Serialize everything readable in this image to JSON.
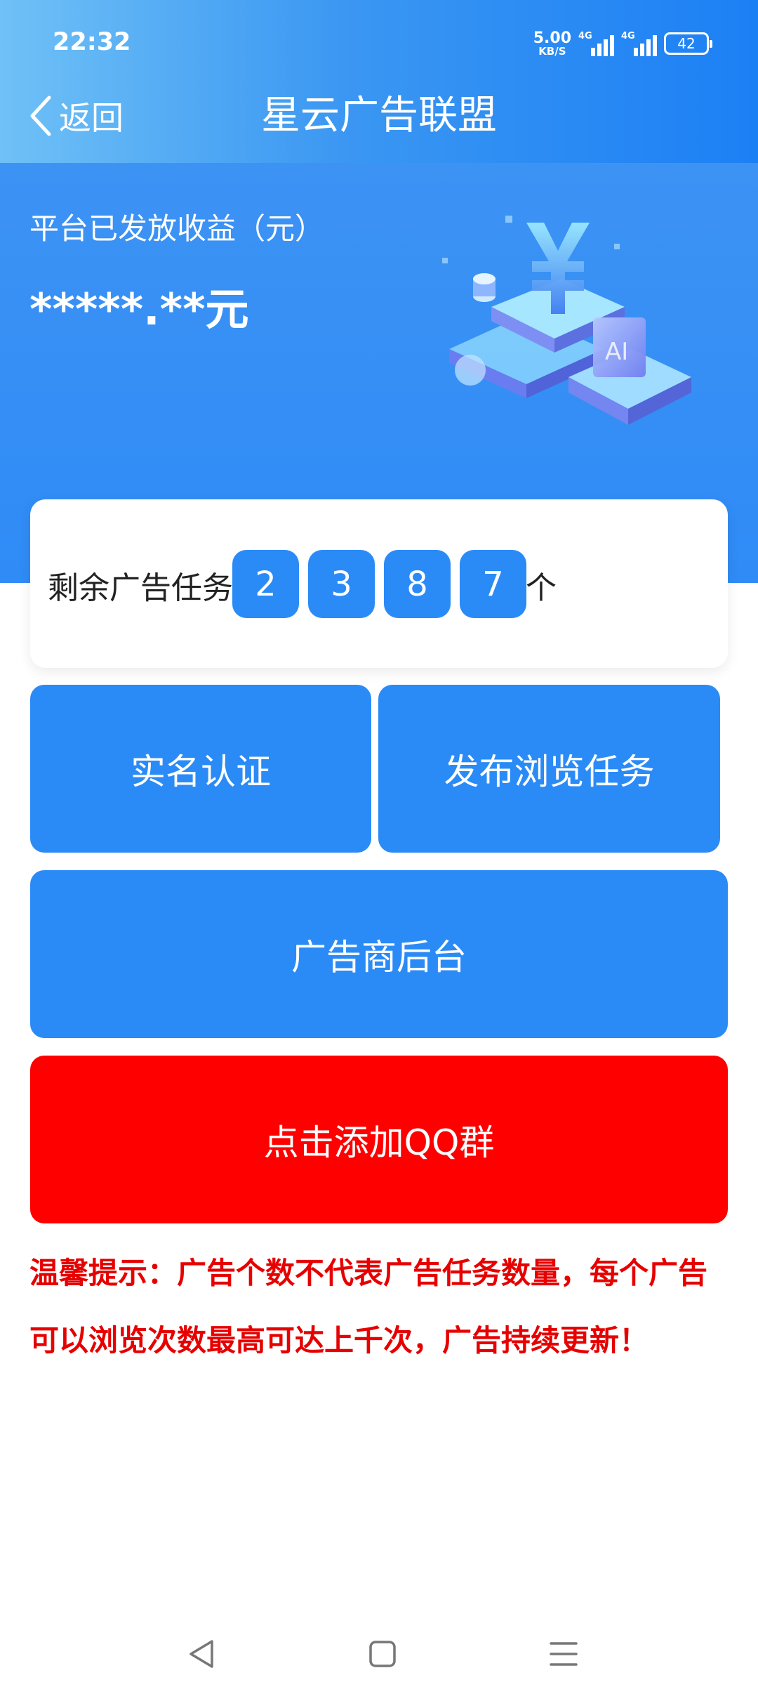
{
  "status_bar": {
    "time": "22:32",
    "net_speed_value": "5.00",
    "net_speed_unit": "KB/S",
    "signal1_label": "4G",
    "signal2_label": "4G",
    "battery": "42"
  },
  "nav": {
    "back_label": "返回",
    "title": "星云广告联盟",
    "back_icon": "chevron-left-icon"
  },
  "banner": {
    "label": "平台已发放收益（元）",
    "amount": "*****.**元"
  },
  "task_card": {
    "label": "剩余广告任务",
    "digits": [
      "2",
      "3",
      "8",
      "7"
    ],
    "unit": "个"
  },
  "buttons": {
    "verify": "实名认证",
    "publish": "发布浏览任务",
    "backend": "广告商后台",
    "qq_group": "点击添加QQ群"
  },
  "tip": "温馨提示：广告个数不代表广告任务数量，每个广告可以浏览次数最高可达上千次，广告持续更新！",
  "colors": {
    "primary_blue": "#2a8bf7",
    "header_blue": "#1c80f5",
    "red_button": "#fe0000",
    "tip_red": "#e60000"
  },
  "system_nav_icons": [
    "back-triangle-icon",
    "home-square-icon",
    "menu-lines-icon"
  ]
}
